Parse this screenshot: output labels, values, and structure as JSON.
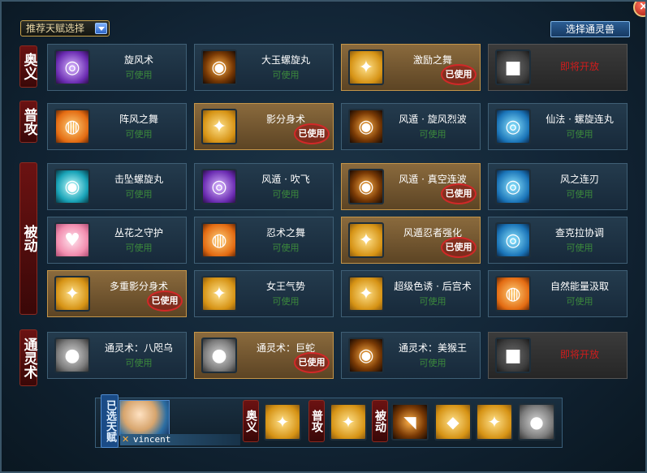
{
  "header": {
    "recommend_select": "推荐天赋选择",
    "beast_button": "选择通灵兽",
    "close": "×"
  },
  "categories": {
    "ougi": "奥义",
    "normal": "普攻",
    "passive": "被动",
    "summon": "通灵术"
  },
  "cards": [
    {
      "name": "旋风术",
      "status": "可使用",
      "used": false,
      "locked": false,
      "icon": "tornado-icon",
      "color": "purple"
    },
    {
      "name": "大玉螺旋丸",
      "status": "可使用",
      "used": false,
      "locked": false,
      "icon": "rasengan-icon",
      "color": "dark"
    },
    {
      "name": "激励之舞",
      "status": "",
      "used": true,
      "locked": false,
      "icon": "dance-icon",
      "color": "gold"
    },
    {
      "name": "即将开放",
      "status": "",
      "used": false,
      "locked": true,
      "icon": "lock-icon",
      "color": "lock"
    },
    {
      "name": "阵风之舞",
      "status": "可使用",
      "used": false,
      "locked": false,
      "icon": "wind-dance-icon",
      "color": "orange"
    },
    {
      "name": "影分身术",
      "status": "",
      "used": true,
      "locked": false,
      "icon": "clone-icon",
      "color": "gold"
    },
    {
      "name": "风遁 · 旋风烈波",
      "status": "可使用",
      "used": false,
      "locked": false,
      "icon": "wind-wave-icon",
      "color": "dark"
    },
    {
      "name": "仙法 · 螺旋连丸",
      "status": "可使用",
      "used": false,
      "locked": false,
      "icon": "sage-rasengan-icon",
      "color": "blue"
    },
    {
      "name": "击坠螺旋丸",
      "status": "可使用",
      "used": false,
      "locked": false,
      "icon": "drop-rasengan-icon",
      "color": "cyan"
    },
    {
      "name": "风遁 · 吹飞",
      "status": "可使用",
      "used": false,
      "locked": false,
      "icon": "fan-icon",
      "color": "purple"
    },
    {
      "name": "风遁 · 真空连波",
      "status": "",
      "used": true,
      "locked": false,
      "icon": "vacuum-wave-icon",
      "color": "dark"
    },
    {
      "name": "风之连刃",
      "status": "可使用",
      "used": false,
      "locked": false,
      "icon": "wind-blade-icon",
      "color": "blue"
    },
    {
      "name": "丛花之守护",
      "status": "可使用",
      "used": false,
      "locked": false,
      "icon": "flower-guard-icon",
      "color": "pink"
    },
    {
      "name": "忍术之舞",
      "status": "可使用",
      "used": false,
      "locked": false,
      "icon": "scroll-icon",
      "color": "orange"
    },
    {
      "name": "风遁忍者强化",
      "status": "",
      "used": true,
      "locked": false,
      "icon": "wind-kanji-icon",
      "color": "gold"
    },
    {
      "name": "查克拉协调",
      "status": "可使用",
      "used": false,
      "locked": false,
      "icon": "chakra-hand-icon",
      "color": "blue"
    },
    {
      "name": "多重影分身术",
      "status": "",
      "used": true,
      "locked": false,
      "icon": "multi-clone-icon",
      "color": "gold"
    },
    {
      "name": "女王气势",
      "status": "可使用",
      "used": false,
      "locked": false,
      "icon": "queen-icon",
      "color": "gold"
    },
    {
      "name": "超级色诱 · 后宫术",
      "status": "可使用",
      "used": false,
      "locked": false,
      "icon": "harem-icon",
      "color": "gold"
    },
    {
      "name": "自然能量汲取",
      "status": "可使用",
      "used": false,
      "locked": false,
      "icon": "nature-energy-icon",
      "color": "orange"
    },
    {
      "name": "通灵术：八咫乌",
      "status": "可使用",
      "used": false,
      "locked": false,
      "icon": "crow-icon",
      "color": "grey"
    },
    {
      "name": "通灵术：巨蛇",
      "status": "",
      "used": true,
      "locked": false,
      "icon": "snake-icon",
      "color": "grey"
    },
    {
      "name": "通灵术：美猴王",
      "status": "可使用",
      "used": false,
      "locked": false,
      "icon": "monkey-king-icon",
      "color": "dark"
    },
    {
      "name": "即将开放",
      "status": "",
      "used": false,
      "locked": true,
      "icon": "lock-icon",
      "color": "lock"
    }
  ],
  "used_stamp": "已使用",
  "bottom": {
    "chosen_label": "已选天赋",
    "username": "vincent",
    "ougi": "奥义",
    "normal": "普攻",
    "passive": "被动"
  }
}
